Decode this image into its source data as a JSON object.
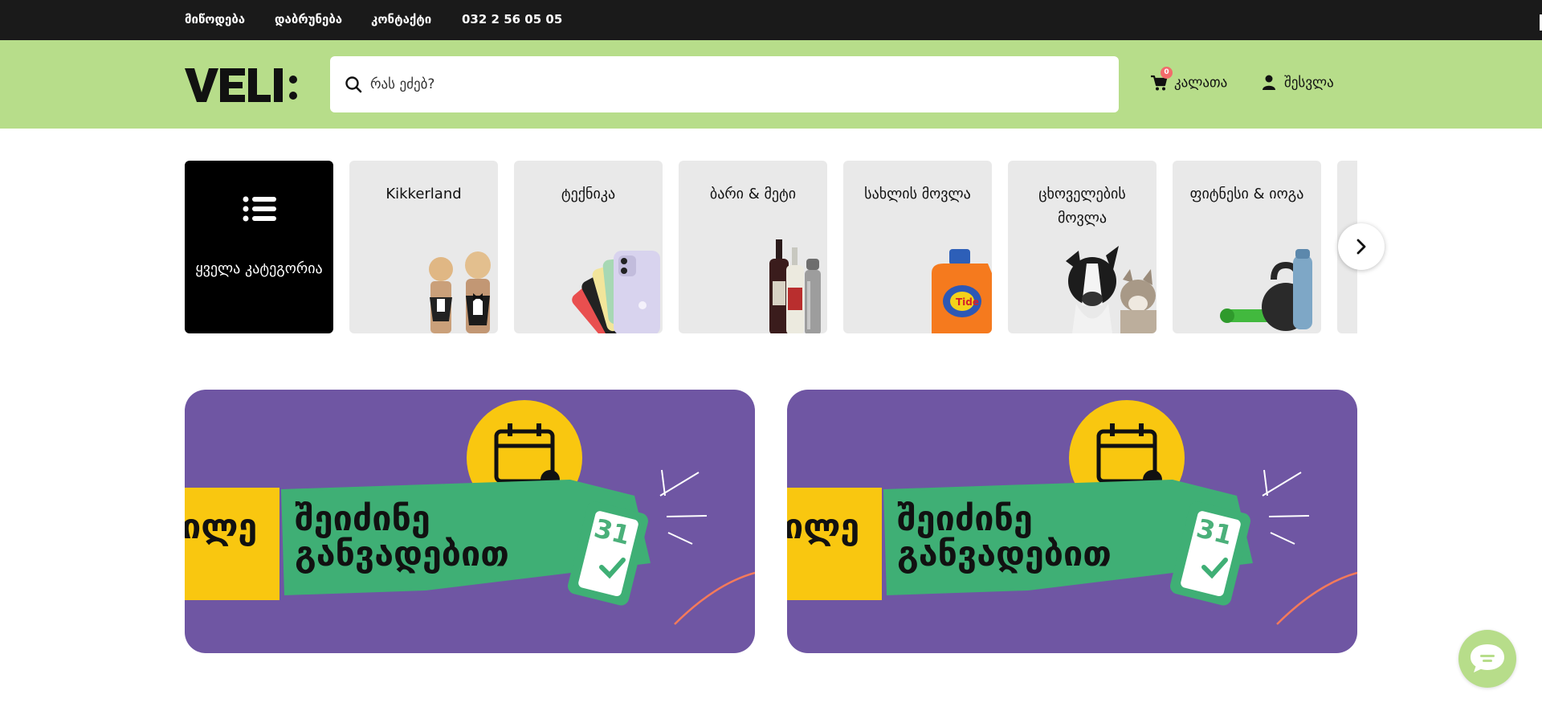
{
  "topbar": {
    "links": [
      "მიწოდება",
      "დაბრუნება",
      "კონტაქტი",
      "032 2 56 05 05"
    ]
  },
  "header": {
    "logo_text": "VELI:",
    "search": {
      "placeholder": "რას ეძებ?",
      "value": ""
    },
    "cart": {
      "label": "კალათა",
      "count": "0"
    },
    "login": {
      "label": "შესვლა"
    }
  },
  "categories": [
    {
      "label": "ყველა კატეგორია",
      "icon": "list-icon"
    },
    {
      "label": "Kikkerland"
    },
    {
      "label": "ტექნიკა"
    },
    {
      "label": "ბარი & მეტი"
    },
    {
      "label": "სახლის მოვლა"
    },
    {
      "label": "ცხოველების მოვლა"
    },
    {
      "label": "ფიტნესი & იოგა"
    }
  ],
  "banners": [
    {
      "line1": "შეიძინე",
      "line2": "განვადებით",
      "fragment": "ილე",
      "day": "31"
    },
    {
      "line1": "შეიძინე",
      "line2": "განვადებით",
      "fragment": "ილე",
      "day": "31"
    }
  ],
  "colors": {
    "topbar": "#1a1a1a",
    "header": "#b7dd8a",
    "banner_bg": "#6f56a3",
    "banner_green": "#3faf75",
    "banner_yellow": "#f9c710",
    "badge": "#f26b6b"
  }
}
